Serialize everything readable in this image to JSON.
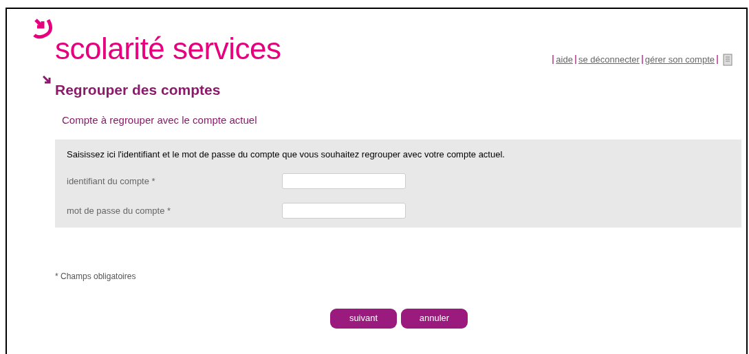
{
  "header": {
    "logo": "scolarité services",
    "links": [
      {
        "label": "aide"
      },
      {
        "label": "se déconnecter"
      },
      {
        "label": "gérer son compte"
      }
    ]
  },
  "page_title": "Regrouper des comptes",
  "section_title": "Compte à regrouper avec le compte actuel",
  "form": {
    "instructions": "Saisissez ici l'identifiant et le mot de passe du compte que vous souhaitez regrouper avec votre compte actuel.",
    "fields": [
      {
        "label": "identifiant du compte *"
      },
      {
        "label": "mot de passe du compte *"
      }
    ]
  },
  "footnote": "* Champs obligatoires",
  "buttons": [
    {
      "label": "suivant"
    },
    {
      "label": "annuler"
    }
  ]
}
